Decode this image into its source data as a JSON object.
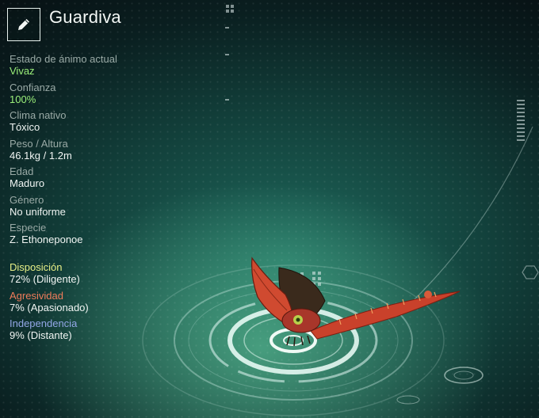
{
  "creature_name": "Guardiva",
  "edit_icon": "pencil-icon",
  "stats": [
    {
      "label": "Estado de ánimo actual",
      "value": "Vivaz"
    },
    {
      "label": "Confianza",
      "value": "100%"
    },
    {
      "label": "Clima nativo",
      "value": "Tóxico"
    },
    {
      "label": "Peso / Altura",
      "value": "46.1kg / 1.2m"
    },
    {
      "label": "Edad",
      "value": "Maduro"
    },
    {
      "label": "Género",
      "value": "No uniforme"
    },
    {
      "label": "Especie",
      "value": "Z. Ethoneponoe"
    }
  ],
  "traits": [
    {
      "label": "Disposición",
      "value": "72% (Diligente)",
      "color": "#e6ee86"
    },
    {
      "label": "Agresividad",
      "value": "7% (Apasionado)",
      "color": "#ee7b5a"
    },
    {
      "label": "Independencia",
      "value": "9% (Distante)",
      "color": "#92a6e6"
    }
  ],
  "colors": {
    "highlight_green": "#9bf07a",
    "creature_red": "#d2452c"
  }
}
